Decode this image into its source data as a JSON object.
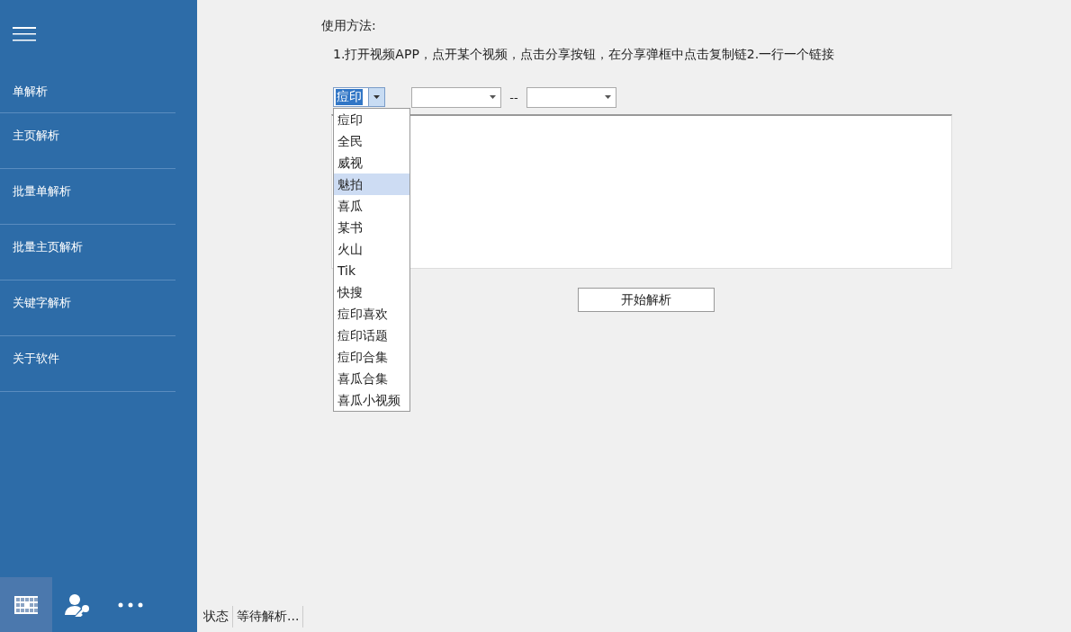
{
  "sidebar": {
    "items": [
      {
        "label": "单解析"
      },
      {
        "label": "主页解析"
      },
      {
        "label": "批量单解析"
      },
      {
        "label": "批量主页解析"
      },
      {
        "label": "关键字解析"
      },
      {
        "label": "关于软件"
      }
    ],
    "bottom_icons": [
      {
        "kind": "grid",
        "selected": true
      },
      {
        "kind": "user-key",
        "selected": false
      },
      {
        "kind": "more",
        "selected": false
      }
    ]
  },
  "usage": {
    "title": "使用方法:",
    "text": "1.打开视频APP，点开某个视频，点击分享按钮，在分享弹框中点击复制链2.一行一个链接"
  },
  "platform_combo": {
    "value": "痘印",
    "expanded": true,
    "options": [
      {
        "label": "痘印",
        "highlighted": false
      },
      {
        "label": "全民",
        "highlighted": false
      },
      {
        "label": "威视",
        "highlighted": false
      },
      {
        "label": "魅拍",
        "highlighted": true
      },
      {
        "label": "喜瓜",
        "highlighted": false
      },
      {
        "label": "某书",
        "highlighted": false
      },
      {
        "label": "火山",
        "highlighted": false
      },
      {
        "label": "Tik",
        "highlighted": false
      },
      {
        "label": "快搜",
        "highlighted": false
      },
      {
        "label": "痘印喜欢",
        "highlighted": false
      },
      {
        "label": "痘印话题",
        "highlighted": false
      },
      {
        "label": "痘印合集",
        "highlighted": false
      },
      {
        "label": "喜瓜合集",
        "highlighted": false
      },
      {
        "label": "喜瓜小视频",
        "highlighted": false
      }
    ]
  },
  "range_separator": "--",
  "start_button": "开始解析",
  "status_bar": [
    "状态",
    "等待解析..."
  ]
}
